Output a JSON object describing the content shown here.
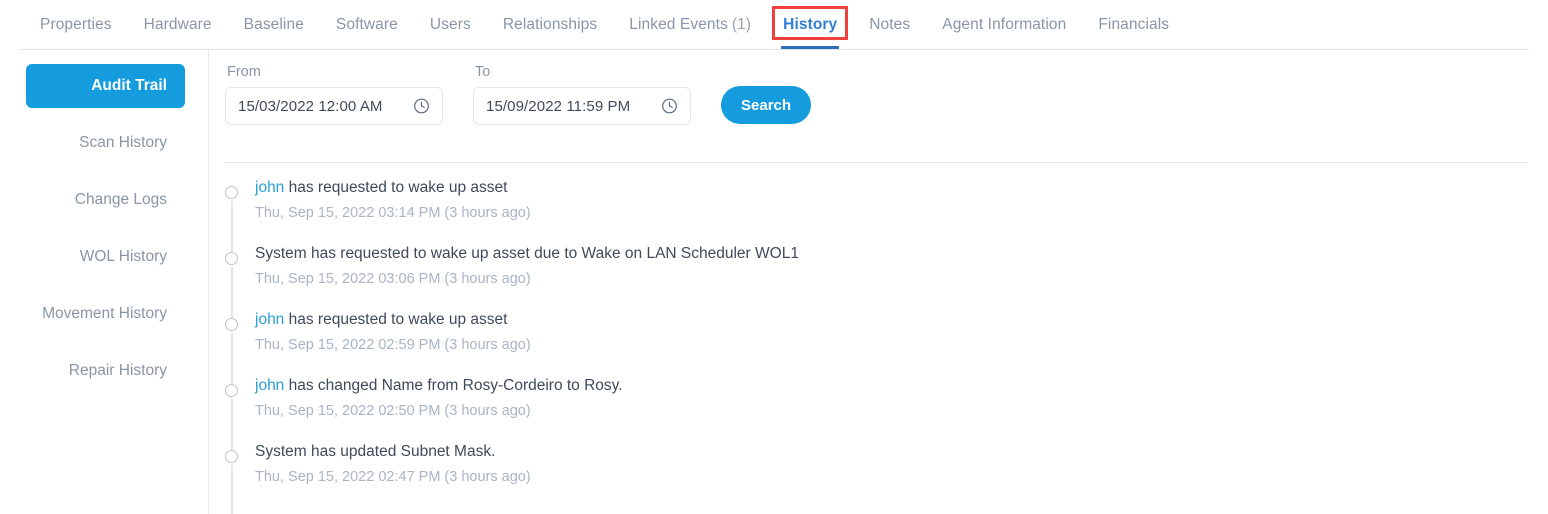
{
  "tabs": [
    {
      "label": "Properties",
      "active": false
    },
    {
      "label": "Hardware",
      "active": false
    },
    {
      "label": "Baseline",
      "active": false
    },
    {
      "label": "Software",
      "active": false
    },
    {
      "label": "Users",
      "active": false
    },
    {
      "label": "Relationships",
      "active": false
    },
    {
      "label": "Linked Events",
      "count": "(1)",
      "active": false
    },
    {
      "label": "History",
      "active": true,
      "annotated": true
    },
    {
      "label": "Notes",
      "active": false
    },
    {
      "label": "Agent Information",
      "active": false
    },
    {
      "label": "Financials",
      "active": false
    }
  ],
  "sidebar": {
    "items": [
      {
        "label": "Audit Trail",
        "active": true
      },
      {
        "label": "Scan History",
        "active": false
      },
      {
        "label": "Change Logs",
        "active": false
      },
      {
        "label": "WOL History",
        "active": false
      },
      {
        "label": "Movement History",
        "active": false
      },
      {
        "label": "Repair History",
        "active": false
      }
    ]
  },
  "filters": {
    "from": {
      "label": "From",
      "value": "15/03/2022 12:00 AM",
      "icon": "clock-icon"
    },
    "to": {
      "label": "To",
      "value": "15/09/2022 11:59 PM",
      "icon": "clock-icon"
    },
    "search_label": "Search"
  },
  "timeline": {
    "entries": [
      {
        "actor": "john",
        "text": " has requested to wake up asset",
        "timestamp": "Thu, Sep 15, 2022 03:14 PM (3 hours ago)"
      },
      {
        "actor": "",
        "text": "System has requested to wake up asset due to Wake on LAN Scheduler WOL1",
        "timestamp": "Thu, Sep 15, 2022 03:06 PM (3 hours ago)"
      },
      {
        "actor": "john",
        "text": " has requested to wake up asset",
        "timestamp": "Thu, Sep 15, 2022 02:59 PM (3 hours ago)"
      },
      {
        "actor": "john",
        "text": " has changed Name from Rosy-Cordeiro to Rosy.",
        "timestamp": "Thu, Sep 15, 2022 02:50 PM (3 hours ago)"
      },
      {
        "actor": "",
        "text": "System has updated Subnet Mask.",
        "timestamp": "Thu, Sep 15, 2022 02:47 PM (3 hours ago)"
      }
    ]
  },
  "colors": {
    "accent": "#149cdf",
    "active_tab": "#2f7fd1",
    "tab_indicator": "#2f6fb5",
    "annotation": "#f0413e",
    "link": "#2a9fd8",
    "muted": "#8b95a7",
    "timestamp": "#a9b4c5"
  }
}
